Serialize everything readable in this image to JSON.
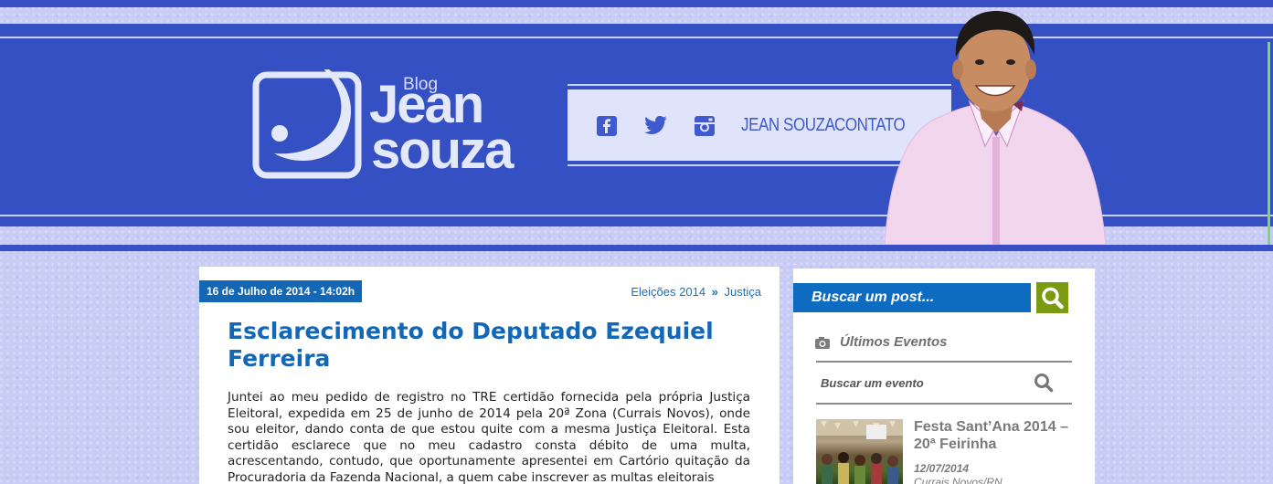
{
  "blog": {
    "prefix": "Blog",
    "name_line1": "Jean",
    "name_line2": "souza"
  },
  "nav": {
    "social": [
      {
        "icon": "facebook-icon"
      },
      {
        "icon": "twitter-icon"
      },
      {
        "icon": "instagram-icon"
      }
    ],
    "links": [
      "JEAN SOUZA",
      "CONTATO"
    ]
  },
  "post": {
    "date": "16 de Julho de 2014 - 14:02h",
    "categories": [
      "Eleições 2014",
      "Justiça"
    ],
    "category_separator": "»",
    "title": "Esclarecimento do Deputado Ezequiel Ferreira",
    "body": "Juntei ao meu pedido de registro no TRE certidão fornecida pela própria Justiça Eleitoral, expedida em 25 de junho de 2014 pela 20ª Zona (Currais Novos), onde sou eleitor, dando conta de que estou quite com a mesma Justiça Eleitoral. Esta certidão esclarece que no meu cadastro consta débito de uma multa, acrescentando, contudo, que oportunamente apresentei em Cartório quitação da Procuradoria da Fazenda Nacional, a quem cabe inscrever as multas eleitorais"
  },
  "sidebar": {
    "search_placeholder": "Buscar um post...",
    "events_heading": "Últimos Eventos",
    "events_search_placeholder": "Buscar um evento",
    "event": {
      "title": "Festa Sant’Ana 2014 – 20ª Feirinha",
      "date": "12/07/2014",
      "place": "Currais Novos/RN"
    }
  },
  "colors": {
    "header_blue": "#3550c2",
    "link_blue": "#1467b5",
    "search_green": "#7a9a12"
  }
}
